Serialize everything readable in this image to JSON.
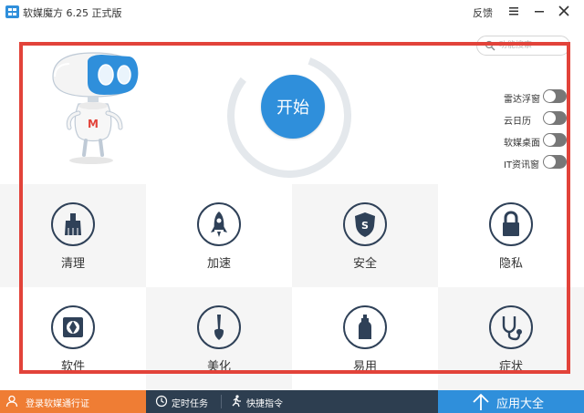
{
  "titlebar": {
    "title": "软媒魔方 6.25 正式版",
    "feedback_label": "反馈"
  },
  "hero": {
    "start_label": "开始",
    "search_placeholder": "功能搜索",
    "toggles": [
      {
        "label": "雷达浮窗",
        "on": false
      },
      {
        "label": "云日历",
        "on": false
      },
      {
        "label": "软媒桌面",
        "on": false
      },
      {
        "label": "IT资讯窗",
        "on": false
      }
    ]
  },
  "tiles": [
    {
      "label": "清理",
      "icon": "broom-icon"
    },
    {
      "label": "加速",
      "icon": "rocket-icon"
    },
    {
      "label": "安全",
      "icon": "shield-icon"
    },
    {
      "label": "隐私",
      "icon": "lock-icon"
    },
    {
      "label": "软件",
      "icon": "aperture-icon"
    },
    {
      "label": "美化",
      "icon": "brush-icon"
    },
    {
      "label": "易用",
      "icon": "bottle-icon"
    },
    {
      "label": "症状",
      "icon": "stethoscope-icon"
    }
  ],
  "bottombar": {
    "login_label": "登录软媒通行证",
    "scheduled_label": "定时任务",
    "shortcut_label": "快捷指令",
    "appstore_label": "应用大全"
  },
  "colors": {
    "accent_blue": "#2f8fdb",
    "orange": "#ef7d34",
    "navy": "#2d3e50",
    "highlight_red": "#e2433a"
  }
}
